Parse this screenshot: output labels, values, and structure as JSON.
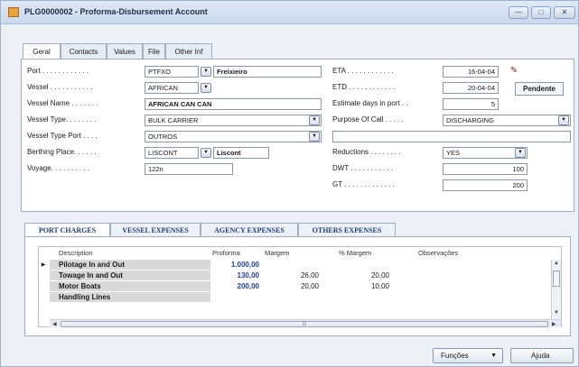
{
  "window": {
    "title": "PLG0000002 - Proforma-Disbursement Account",
    "controls": [
      "—",
      "□",
      "✕"
    ]
  },
  "tabs": [
    "Geral",
    "Contacts",
    "Values",
    "File",
    "Other Inf"
  ],
  "left_fields": {
    "port": {
      "label": "Port . . . . . . . . . . . .",
      "code": "PTFXO",
      "name": "Freixieiro"
    },
    "vessel": {
      "label": "Vessel . . . . . . . . . . .",
      "value": "AFRICAN"
    },
    "vessel_name": {
      "label": "Vessel Name . . . . . . .",
      "value": "AFRICAN CAN CAN"
    },
    "vessel_type": {
      "label": "Vessel Type. . . . . . . .",
      "value": "BULK CARRIER"
    },
    "vessel_type_port": {
      "label": "Vessel Type Port . . . .",
      "value": "OUTROS"
    },
    "berthing_place": {
      "label": "Berthing Place. . . . . .",
      "code": "LISCONT",
      "name": "Liscont"
    },
    "voyage": {
      "label": "Voyage. . . . . . . . . .",
      "value": "122n"
    }
  },
  "right_fields": {
    "eta": {
      "label": "ETA . . . . . . . . . . . .",
      "value": "16-04-04"
    },
    "etd": {
      "label": "ETD . . . . . . . . . . . .",
      "value": "20-04-04"
    },
    "estimate_days": {
      "label": "Estimate days in port . .",
      "value": "5"
    },
    "purpose": {
      "label": "Purpose Of Call . . . . .",
      "value": "DISCHARGING"
    },
    "reductions": {
      "label": "Reductions . . . . . . . .",
      "value": "YES"
    },
    "dwt": {
      "label": "DWT . . . . . . . . . . .",
      "value": "100"
    },
    "gt": {
      "label": "GT . . . . . . . . . . . . .",
      "value": "200"
    },
    "status": "Pendente"
  },
  "subtabs": [
    "PORT CHARGES",
    "VESSEL EXPENSES",
    "AGENCY EXPENSES",
    "OTHERS EXPENSES"
  ],
  "grid": {
    "headers": [
      "Description",
      "Proforma",
      "Margem",
      "% Margem",
      "Observações"
    ],
    "rows": [
      {
        "description": "Pilotage In and Out",
        "proforma": "1.000,00",
        "margem": "",
        "pct": "",
        "obs": ""
      },
      {
        "description": "Towage In and Out",
        "proforma": "130,00",
        "margem": "26,00",
        "pct": "20,00",
        "obs": ""
      },
      {
        "description": "Motor Boats",
        "proforma": "200,00",
        "margem": "20,00",
        "pct": "10,00",
        "obs": ""
      },
      {
        "description": "Handling Lines",
        "proforma": "",
        "margem": "",
        "pct": "",
        "obs": ""
      }
    ],
    "selected_marker": "▶"
  },
  "footer": {
    "funcoes": "Funções",
    "ajuda": "Ajuda"
  }
}
